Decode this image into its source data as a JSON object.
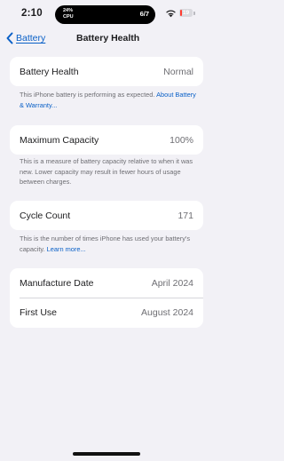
{
  "status_bar": {
    "time": "2:10",
    "cpu_percent": "24%",
    "cpu_label": "CPU",
    "island_count": "6/7",
    "battery_level": "19",
    "battery_fraction": 0.19,
    "battery_color": "#ff3b30"
  },
  "nav": {
    "back_label": "Battery",
    "title": "Battery Health"
  },
  "battery_health": {
    "label": "Battery Health",
    "value": "Normal",
    "footer_text": "This iPhone battery is performing as expected. ",
    "footer_link": "About Battery & Warranty..."
  },
  "maximum_capacity": {
    "label": "Maximum Capacity",
    "value": "100%",
    "footer_text": "This is a measure of battery capacity relative to when it was new. Lower capacity may result in fewer hours of usage between charges."
  },
  "cycle_count": {
    "label": "Cycle Count",
    "value": "171",
    "footer_text": "This is the number of times iPhone has used your battery's capacity. ",
    "footer_link": "Learn more..."
  },
  "dates": {
    "manufacture_label": "Manufacture Date",
    "manufacture_value": "April 2024",
    "first_use_label": "First Use",
    "first_use_value": "August 2024"
  },
  "colors": {
    "accent": "#0a60c7",
    "background": "#f2f1f6"
  }
}
